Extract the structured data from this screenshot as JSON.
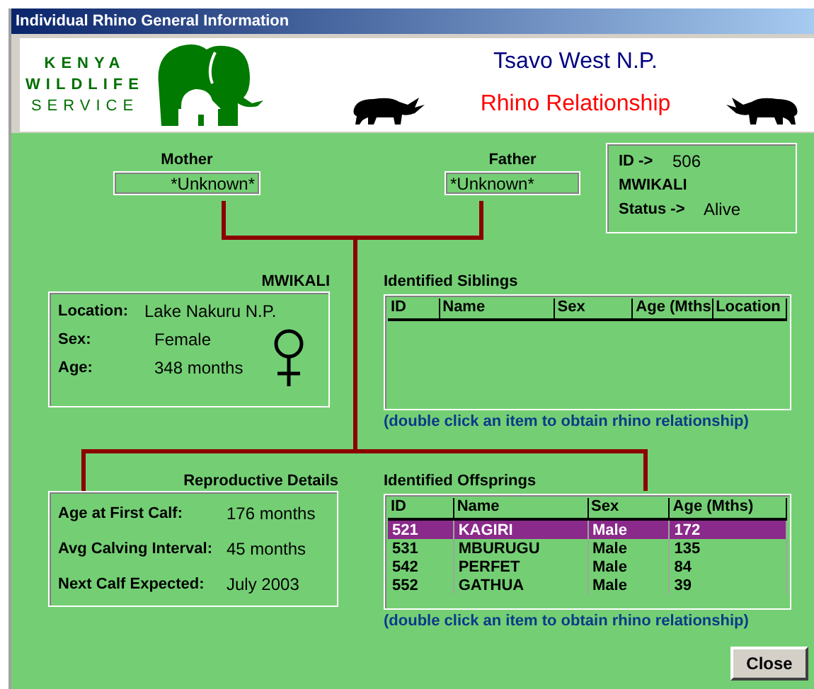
{
  "window": {
    "title": "Individual Rhino General Information"
  },
  "header": {
    "logo_lines": [
      "KENYA",
      "WILDLIFE",
      "SERVICE"
    ],
    "park": "Tsavo West N.P.",
    "heading": "Rhino Relationship"
  },
  "parents": [
    {
      "label": "Mother",
      "value": "*Unknown*"
    },
    {
      "label": "Father",
      "value": "*Unknown*"
    }
  ],
  "summary": {
    "id_label": "ID ->",
    "id": "506",
    "name": "MWIKALI",
    "status_label": "Status ->",
    "status": "Alive"
  },
  "rhino": {
    "name": "MWIKALI",
    "kind": "female",
    "fields": [
      {
        "label": "Location:",
        "value": "Lake Nakuru N.P."
      },
      {
        "label": "Sex:",
        "value": "Female"
      },
      {
        "label": "Age:",
        "value": "348 months"
      }
    ]
  },
  "siblings": {
    "title": "Identified Siblings",
    "columns": [
      "ID",
      "Name",
      "Sex",
      "Age (Mths",
      "Location"
    ],
    "note": "(double click an item to obtain rhino relationship)"
  },
  "reproductive": {
    "title": "Reproductive Details",
    "fields": [
      {
        "label": "Age at First Calf:",
        "value": "176 months"
      },
      {
        "label": "Avg Calving Interval:",
        "value": "45 months"
      },
      {
        "label": "Next Calf Expected:",
        "value": "July 2003"
      }
    ]
  },
  "offspring": {
    "title": "Identified Offsprings",
    "columns": [
      "ID",
      "Name",
      "Sex",
      "Age (Mths)"
    ],
    "rows": [
      {
        "cells": [
          "521",
          "KAGIRI",
          "Male",
          "172"
        ],
        "selected": true
      },
      {
        "cells": [
          "531",
          "MBURUGU",
          "Male",
          "135"
        ],
        "selected": false
      },
      {
        "cells": [
          "542",
          "PERFET",
          "Male",
          "84"
        ],
        "selected": false
      },
      {
        "cells": [
          "552",
          "GATHUA",
          "Male",
          "39"
        ],
        "selected": false
      }
    ],
    "note": "(double click an item to obtain rhino relationship)"
  },
  "buttons": [
    {
      "label": "Close"
    }
  ]
}
